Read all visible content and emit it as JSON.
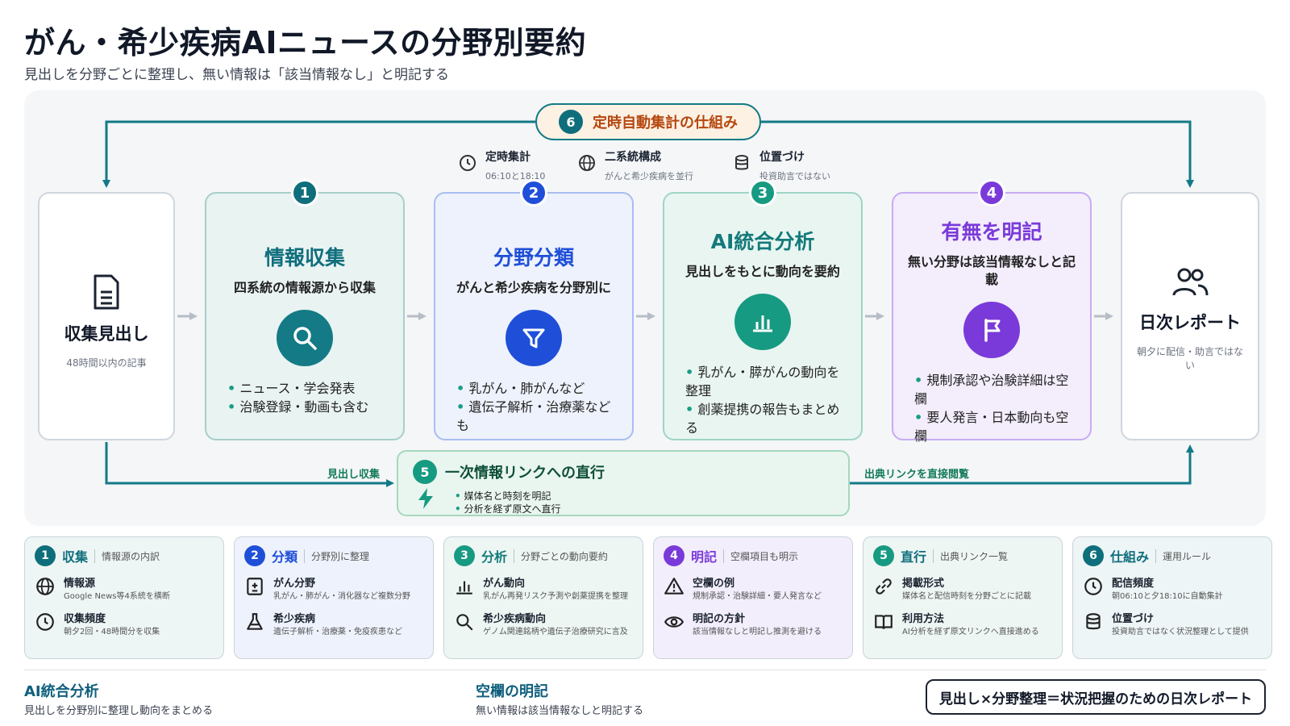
{
  "header": {
    "title": "がん・希少疾病AIニュースの分野別要約",
    "subtitle": "見出しを分野ごとに整理し、無い情報は「該当情報なし」と明記する"
  },
  "loop": {
    "num": "6",
    "label": "定時自動集計の仕組み"
  },
  "features": [
    {
      "icon": "clock-icon",
      "title": "定時集計",
      "sub": "06:10と18:10"
    },
    {
      "icon": "globe-icon",
      "title": "二系統構成",
      "sub": "がんと希少疾病を並行"
    },
    {
      "icon": "database-icon",
      "title": "位置づけ",
      "sub": "投資助言ではない"
    }
  ],
  "source": {
    "title": "収集見出し",
    "sub": "48時間以内の記事"
  },
  "steps": [
    {
      "num": "1",
      "title": "情報収集",
      "sub": "四系統の情報源から収集",
      "icon": "search-icon",
      "color": "#0f6e7c",
      "bullets": [
        "ニュース・学会発表",
        "治験登録・動画も含む"
      ]
    },
    {
      "num": "2",
      "title": "分野分類",
      "sub": "がんと希少疾病を分野別に",
      "icon": "filter-icon",
      "color": "#1f4fd8",
      "bullets": [
        "乳がん・肺がんなど",
        "遺伝子解析・治療薬なども"
      ]
    },
    {
      "num": "3",
      "title": "AI統合分析",
      "sub": "見出しをもとに動向を要約",
      "icon": "bar-chart-icon",
      "color": "#179a82",
      "bullets": [
        "乳がん・膵がんの動向を整理",
        "創薬提携の報告もまとめる"
      ]
    },
    {
      "num": "4",
      "title": "有無を明記",
      "sub": "無い分野は該当情報なしと記載",
      "icon": "flag-icon",
      "color": "#7a3ad9",
      "bullets": [
        "規制承認や治験詳細は空欄",
        "要人発言・日本動向も空欄"
      ]
    }
  ],
  "report": {
    "title": "日次レポート",
    "sub": "朝夕に配信・助言ではない"
  },
  "direct": {
    "num": "5",
    "title": "一次情報リンクへの直行",
    "bullets": [
      "媒体名と時刻を明記",
      "分析を経ず原文へ直行"
    ],
    "left_label": "見出し収集",
    "right_label": "出典リンクを直接閲覧"
  },
  "cards": [
    {
      "num": "1",
      "title": "収集",
      "sub": "情報源の内訳",
      "items": [
        {
          "icon": "globe-icon",
          "a": "情報源",
          "b": "Google News等4系統を横断"
        },
        {
          "icon": "clock-icon",
          "a": "収集頻度",
          "b": "朝夕2回・48時間分を収集"
        }
      ]
    },
    {
      "num": "2",
      "title": "分類",
      "sub": "分野別に整理",
      "items": [
        {
          "icon": "medical-box-icon",
          "a": "がん分野",
          "b": "乳がん・肺がん・消化器など複数分野"
        },
        {
          "icon": "flask-icon",
          "a": "希少疾病",
          "b": "遺伝子解析・治療薬・免疫疾患など"
        }
      ]
    },
    {
      "num": "3",
      "title": "分析",
      "sub": "分野ごとの動向要約",
      "items": [
        {
          "icon": "bar-chart-icon",
          "a": "がん動向",
          "b": "乳がん再発リスク予測や創薬提携を整理"
        },
        {
          "icon": "search-icon",
          "a": "希少疾病動向",
          "b": "ゲノム関連銘柄や遺伝子治療研究に言及"
        }
      ]
    },
    {
      "num": "4",
      "title": "明記",
      "sub": "空欄項目も明示",
      "items": [
        {
          "icon": "warning-icon",
          "a": "空欄の例",
          "b": "規制承認・治験詳細・要人発言など"
        },
        {
          "icon": "eye-icon",
          "a": "明記の方針",
          "b": "該当情報なしと明記し推測を避ける"
        }
      ]
    },
    {
      "num": "5",
      "title": "直行",
      "sub": "出典リンク一覧",
      "items": [
        {
          "icon": "link-icon",
          "a": "掲載形式",
          "b": "媒体名と配信時刻を分野ごとに記載"
        },
        {
          "icon": "book-icon",
          "a": "利用方法",
          "b": "AI分析を経ず原文リンクへ直接進める"
        }
      ]
    },
    {
      "num": "6",
      "title": "仕組み",
      "sub": "運用ルール",
      "items": [
        {
          "icon": "clock-icon",
          "a": "配信頻度",
          "b": "朝06:10と夕18:10に自動集計"
        },
        {
          "icon": "database-icon",
          "a": "位置づけ",
          "b": "投資助言ではなく状況整理として提供"
        }
      ]
    }
  ],
  "footer": {
    "left_title": "AI統合分析",
    "left_sub": "見出しを分野別に整理し動向をまとめる",
    "mid_title": "空欄の明記",
    "mid_sub": "無い情報は該当情報なしと明記する",
    "summary": "見出し×分野整理＝状況把握のための日次レポート"
  },
  "colors": {
    "teal": "#0f6e7c",
    "blue": "#1f4fd8",
    "green": "#179a82",
    "purple": "#7a3ad9",
    "orange": "#b5470f"
  }
}
